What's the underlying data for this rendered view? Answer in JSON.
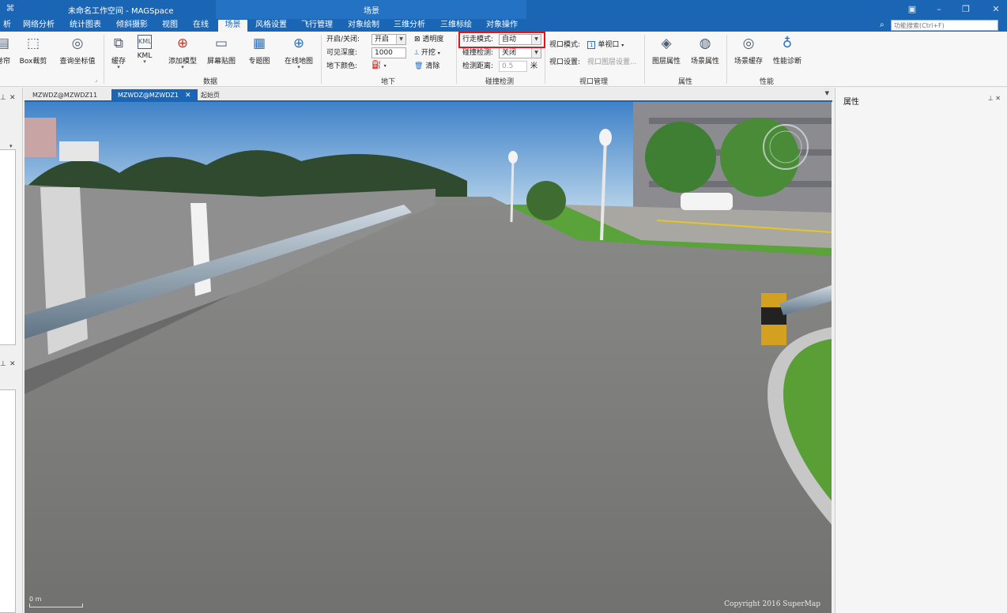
{
  "window": {
    "app_icon": "app-logo-icon",
    "title": "未命名工作空间 - MAGSpace",
    "context_tab_group": "场景",
    "controls": [
      "minimize-icon",
      "restore-icon",
      "close-icon"
    ]
  },
  "menu": {
    "tabs": [
      {
        "label": "析"
      },
      {
        "label": "网络分析"
      },
      {
        "label": "统计图表"
      },
      {
        "label": "倾斜摄影"
      },
      {
        "label": "视图"
      },
      {
        "label": "在线"
      },
      {
        "label": "场景",
        "active": true
      },
      {
        "label": "风格设置"
      },
      {
        "label": "飞行管理"
      },
      {
        "label": "对象绘制"
      },
      {
        "label": "三维分析"
      },
      {
        "label": "三维标绘"
      },
      {
        "label": "对象操作"
      }
    ],
    "search_placeholder": "功能搜索(Ctrl+F)"
  },
  "ribbon": {
    "buttons": {
      "roll": "卷帘",
      "boxclip": "Box裁剪",
      "query_coord": "查询坐标值",
      "cache": "缓存",
      "kml": "KML",
      "add_model": "添加模型",
      "screen_paste": "屏幕贴图",
      "thematic": "专题图",
      "online_map": "在线地图",
      "layer_props": "图层属性",
      "scene_props": "场景属性",
      "scene_cache": "场景缓存",
      "perf_diag": "性能诊断"
    },
    "kml_icon_text": "KML",
    "groups": {
      "data": "数据",
      "underground": "地下",
      "collision": "碰撞检测",
      "viewport": "视口管理",
      "attributes": "属性",
      "performance": "性能"
    },
    "underground": {
      "toggle_label": "开启/关闭:",
      "toggle_value": "开启",
      "depth_label": "可见深度:",
      "depth_value": "1000",
      "color_label": "地下颜色:",
      "transparency": "透明度",
      "excavate": "开挖",
      "clear": "清除"
    },
    "collision": {
      "walk_mode_label": "行走模式:",
      "walk_mode_value": "自动",
      "collision_label": "碰撞检测:",
      "collision_value": "关闭",
      "distance_label": "检测距离:",
      "distance_value": "0.5",
      "distance_unit": "米"
    },
    "viewport": {
      "mode_label": "视口模式:",
      "mode_value": "单视口",
      "settings_label": "视口设置:",
      "settings_value": "视口图层设置..."
    }
  },
  "doc_tabs": [
    {
      "label": "MZWDZ@MZWDZ11",
      "active": false
    },
    {
      "label": "MZWDZ@MZWDZ1",
      "active": true
    },
    {
      "label": "起始页",
      "active": false
    }
  ],
  "right_panel": {
    "title": "属性"
  },
  "scene": {
    "copyright": "Copyright 2016 SuperMap",
    "scale_text": "0 m"
  },
  "colors": {
    "brand": "#1b65b5",
    "highlight_box": "#e3141b"
  }
}
